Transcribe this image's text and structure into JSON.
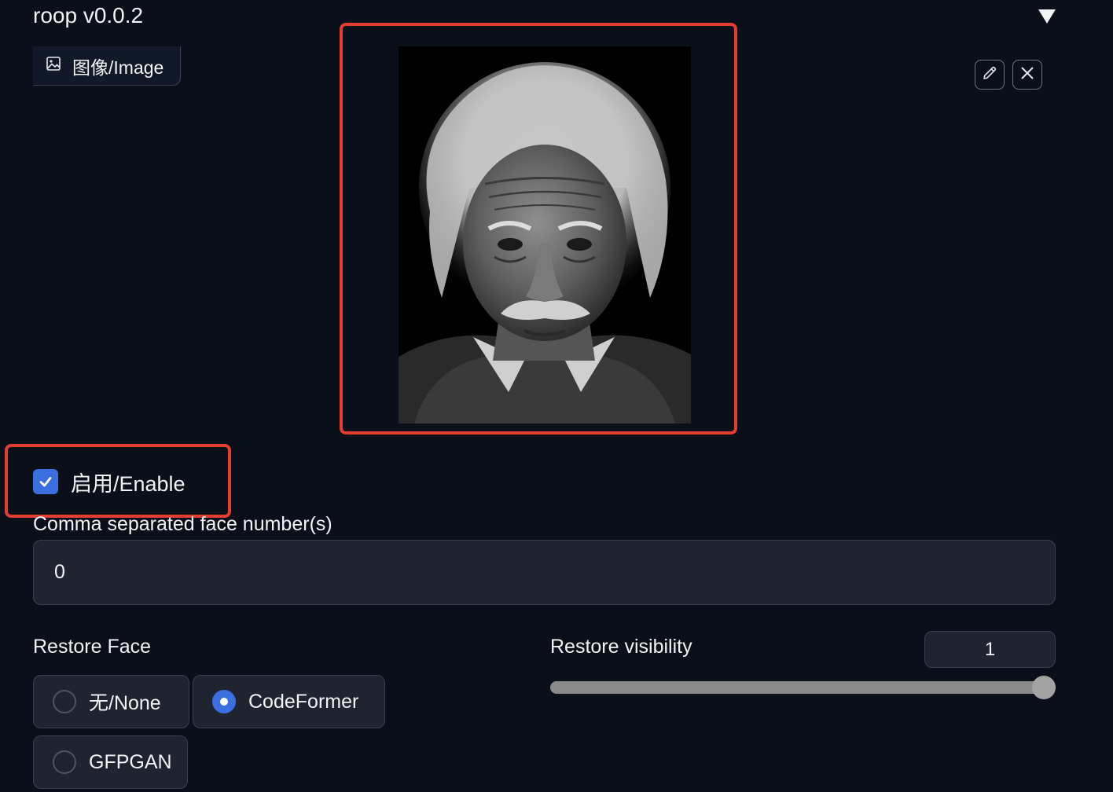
{
  "header": {
    "title": "roop v0.0.2"
  },
  "image_panel": {
    "tab_label": "图像/Image"
  },
  "enable": {
    "label": "启用/Enable",
    "checked": true
  },
  "face_numbers": {
    "label": "Comma separated face number(s)",
    "value": "0"
  },
  "restore_face": {
    "label": "Restore Face",
    "options": [
      {
        "label": "无/None",
        "selected": false
      },
      {
        "label": "CodeFormer",
        "selected": true
      },
      {
        "label": "GFPGAN",
        "selected": false
      }
    ]
  },
  "restore_visibility": {
    "label": "Restore visibility",
    "value": "1",
    "fraction": 1.0
  },
  "colors": {
    "accent": "#3b6fe0",
    "highlight": "#e53d30",
    "background": "#0b0f19"
  }
}
